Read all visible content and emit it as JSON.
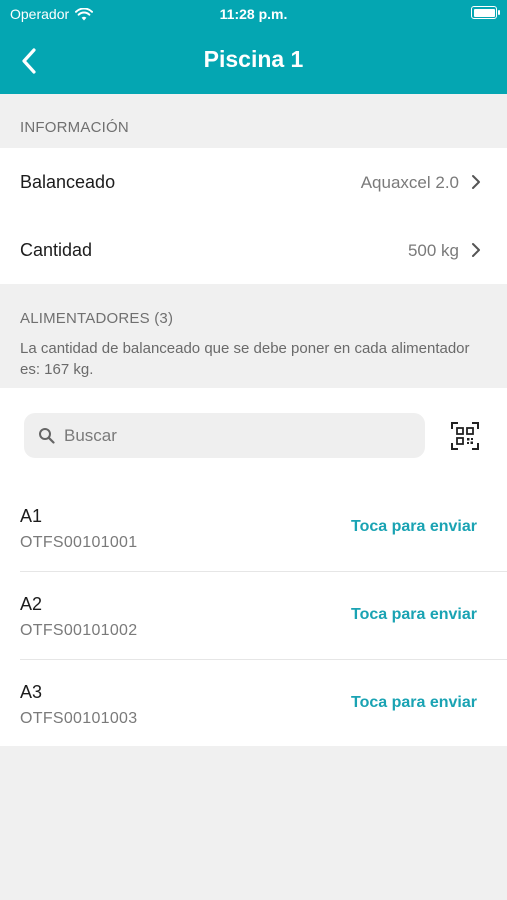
{
  "status_bar": {
    "carrier": "Operador",
    "time": "11:28 p.m.",
    "battery_level": 1.0
  },
  "navbar": {
    "title": "Piscina 1",
    "back_icon": "chevron-left-icon"
  },
  "info_section": {
    "header": "INFORMACIÓN",
    "rows": [
      {
        "label": "Balanceado",
        "value": "Aquaxcel 2.0"
      },
      {
        "label": "Cantidad",
        "value": "500 kg"
      }
    ]
  },
  "feeders_section": {
    "header": "ALIMENTADORES (3)",
    "description": "La cantidad de balanceado que se debe poner en cada alimentador es: 167 kg.",
    "search_placeholder": "Buscar",
    "search_value": "",
    "qr_icon": "qr-code-scan-icon",
    "items": [
      {
        "name": "A1",
        "code": "OTFS00101001",
        "action": "Toca para enviar"
      },
      {
        "name": "A2",
        "code": "OTFS00101002",
        "action": "Toca para enviar"
      },
      {
        "name": "A3",
        "code": "OTFS00101003",
        "action": "Toca para enviar"
      }
    ]
  },
  "colors": {
    "primary": "#04a6b2",
    "accent_text": "#1aa3b3",
    "background": "#f0f0f0"
  }
}
